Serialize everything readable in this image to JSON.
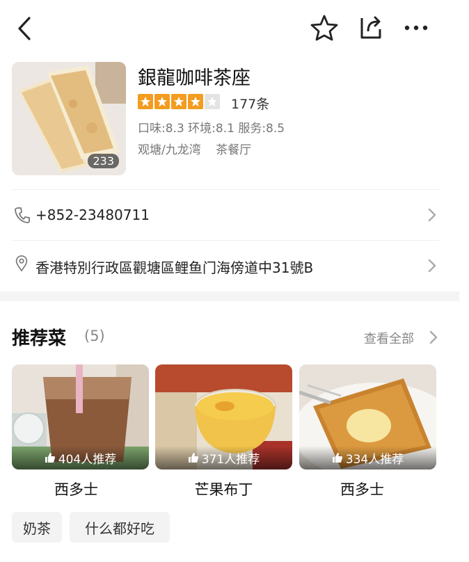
{
  "shop": {
    "name": "銀龍咖啡茶座",
    "rating_stars": 4,
    "rating_max": 5,
    "review_count": "177条",
    "photo_count": "233",
    "scores": "口味:8.3 环境:8.1 服务:8.5",
    "district": "观塘/九龙湾",
    "category": "茶餐厅"
  },
  "contact": {
    "phone": "+852-23480711",
    "address": "香港特別行政區觀塘區鲤鱼门海傍道中31號B"
  },
  "recommended": {
    "title": "推荐菜",
    "count": "(5)",
    "see_all": "查看全部",
    "dishes": [
      {
        "name": "西多士",
        "recommend": "404人推荐"
      },
      {
        "name": "芒果布丁",
        "recommend": "371人推荐"
      },
      {
        "name": "西多士",
        "recommend": "334人推荐"
      }
    ],
    "tags": [
      "奶茶",
      "什么都好吃"
    ]
  },
  "icons": {
    "back": "back-arrow-icon",
    "favorite": "star-outline-icon",
    "share": "share-icon",
    "more": "more-dots-icon",
    "phone": "phone-icon",
    "location": "location-pin-icon",
    "chevron": "chevron-right-icon",
    "thumbs_up": "thumbs-up-icon"
  },
  "colors": {
    "star_filled": "#f39c1f",
    "star_empty": "#e3e3e3",
    "muted_text": "#777777",
    "divider": "#eeeeee"
  }
}
